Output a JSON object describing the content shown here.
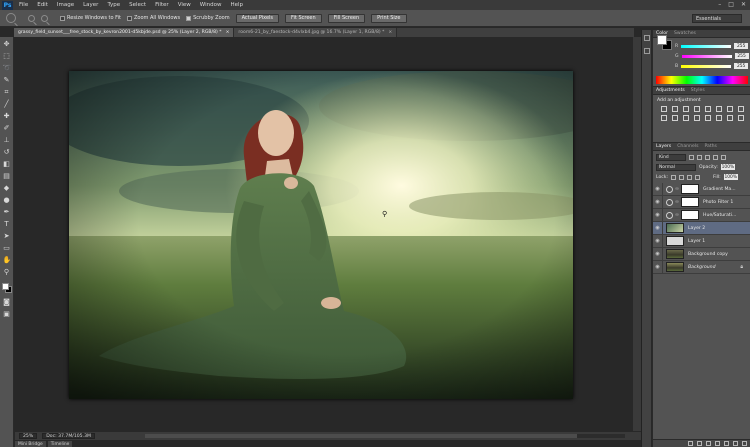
{
  "app": {
    "logo": "Ps",
    "menu": [
      "File",
      "Edit",
      "Image",
      "Layer",
      "Type",
      "Select",
      "Filter",
      "View",
      "Window",
      "Help"
    ],
    "window_controls": [
      "–",
      "□",
      "✕"
    ]
  },
  "options_bar": {
    "checks": [
      {
        "label": "Resize Windows to Fit",
        "checked": false
      },
      {
        "label": "Zoom All Windows",
        "checked": false
      },
      {
        "label": "Scrubby Zoom",
        "checked": true
      }
    ],
    "buttons": [
      "Actual Pixels",
      "Fit Screen",
      "Fill Screen",
      "Print Size"
    ],
    "workspace": "Essentials"
  },
  "tabs": [
    {
      "label": "grassy_field_sunset___free_stock_by_kevron2001-d5kbjde.psd @ 25% (Layer 2, RGB/8) *",
      "active": true
    },
    {
      "label": "room6-21_by_faestock-d4vlxb4.jpg @ 16.7% (Layer 1, RGB/8) *",
      "active": false
    }
  ],
  "status": {
    "zoom": "25%",
    "doc": "Doc: 37.7M/105.3M"
  },
  "bottom_tabs": [
    "Mini Bridge",
    "Timeline"
  ],
  "color_panel": {
    "tabs": [
      "Color",
      "Swatches"
    ],
    "channels": [
      {
        "label": "R",
        "value": "255",
        "gradient": "#ff0000"
      },
      {
        "label": "G",
        "value": "255",
        "gradient": "#00ff00"
      },
      {
        "label": "B",
        "value": "255",
        "gradient": "#0000ff"
      }
    ]
  },
  "adjustments_panel": {
    "tabs": [
      "Adjustments",
      "Styles"
    ],
    "title": "Add an adjustment"
  },
  "layers_panel": {
    "tabs": [
      "Layers",
      "Channels",
      "Paths"
    ],
    "kind": "Kind",
    "blend_mode": "Normal",
    "opacity_label": "Opacity:",
    "opacity": "100%",
    "lock_label": "Lock:",
    "fill_label": "Fill:",
    "fill": "100%",
    "layers": [
      {
        "name": "Gradient Ma...",
        "type": "adjustment",
        "selected": false
      },
      {
        "name": "Photo Filter 1",
        "type": "adjustment",
        "selected": false
      },
      {
        "name": "Hue/Saturati...",
        "type": "adjustment",
        "selected": false
      },
      {
        "name": "Layer 2",
        "type": "pixel",
        "thumb": "layer2",
        "selected": true
      },
      {
        "name": "Layer 1",
        "type": "pixel",
        "thumb": "layer1",
        "selected": false
      },
      {
        "name": "Background copy",
        "type": "pixel",
        "thumb": "bgcopy",
        "selected": false
      },
      {
        "name": "Background",
        "type": "pixel",
        "thumb": "bg",
        "selected": false,
        "locked": true
      }
    ]
  }
}
